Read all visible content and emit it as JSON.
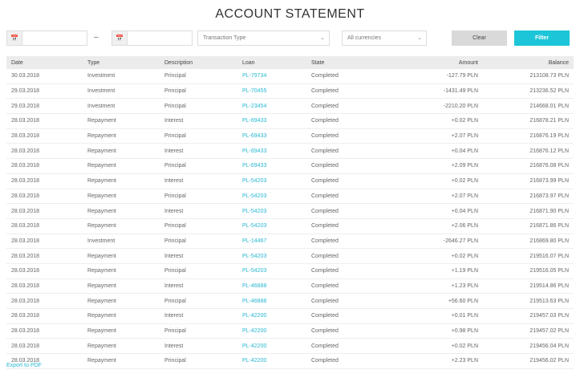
{
  "title": "ACCOUNT STATEMENT",
  "filters": {
    "date_from_value": "",
    "date_to_value": "",
    "dash": "–",
    "transaction_type": "Transaction Type",
    "currency": "All currencies",
    "clear_label": "Clear",
    "filter_label": "Filter"
  },
  "table": {
    "headers": [
      "Date",
      "Type",
      "Description",
      "Loan",
      "State",
      "Amount",
      "Balance"
    ],
    "rows": [
      [
        "30.03.2018",
        "Investment",
        "Principal",
        "PL-79734",
        "Completed",
        "-127.79 PLN",
        "213108.73 PLN"
      ],
      [
        "29.03.2018",
        "Investment",
        "Principal",
        "PL-70455",
        "Completed",
        "-1431.49 PLN",
        "213236.52 PLN"
      ],
      [
        "29.03.2018",
        "Investment",
        "Principal",
        "PL-23454",
        "Completed",
        "-2210.20 PLN",
        "214668.01 PLN"
      ],
      [
        "28.03.2018",
        "Repayment",
        "Interest",
        "PL-69433",
        "Completed",
        "+0.02 PLN",
        "216878.21 PLN"
      ],
      [
        "28.03.2018",
        "Repayment",
        "Principal",
        "PL-69433",
        "Completed",
        "+2.07 PLN",
        "216876.19 PLN"
      ],
      [
        "28.03.2018",
        "Repayment",
        "Interest",
        "PL-69433",
        "Completed",
        "+0.04 PLN",
        "216876.12 PLN"
      ],
      [
        "28.03.2018",
        "Repayment",
        "Principal",
        "PL-69433",
        "Completed",
        "+2.09 PLN",
        "216876.08 PLN"
      ],
      [
        "28.03.2018",
        "Repayment",
        "Interest",
        "PL-54203",
        "Completed",
        "+0.02 PLN",
        "216873.99 PLN"
      ],
      [
        "28.03.2018",
        "Repayment",
        "Principal",
        "PL-54203",
        "Completed",
        "+2.07 PLN",
        "216873.97 PLN"
      ],
      [
        "28.03.2018",
        "Repayment",
        "Interest",
        "PL-54203",
        "Completed",
        "+0.04 PLN",
        "216871.90 PLN"
      ],
      [
        "28.03.2018",
        "Repayment",
        "Principal",
        "PL-54203",
        "Completed",
        "+2.06 PLN",
        "216871.86 PLN"
      ],
      [
        "28.03.2018",
        "Investment",
        "Principal",
        "PL-14467",
        "Completed",
        "-2646.27 PLN",
        "216869.80 PLN"
      ],
      [
        "28.03.2018",
        "Repayment",
        "Interest",
        "PL-54203",
        "Completed",
        "+0.02 PLN",
        "219516.07 PLN"
      ],
      [
        "28.03.2018",
        "Repayment",
        "Principal",
        "PL-54203",
        "Completed",
        "+1.19 PLN",
        "219516.05 PLN"
      ],
      [
        "28.03.2018",
        "Repayment",
        "Interest",
        "PL-46888",
        "Completed",
        "+1.23 PLN",
        "219514.86 PLN"
      ],
      [
        "28.03.2018",
        "Repayment",
        "Principal",
        "PL-46888",
        "Completed",
        "+56.60 PLN",
        "219513.63 PLN"
      ],
      [
        "28.03.2018",
        "Repayment",
        "Interest",
        "PL-42200",
        "Completed",
        "+0.01 PLN",
        "219457.03 PLN"
      ],
      [
        "28.03.2018",
        "Repayment",
        "Principal",
        "PL-42200",
        "Completed",
        "+0.98 PLN",
        "219457.02 PLN"
      ],
      [
        "28.03.2018",
        "Repayment",
        "Interest",
        "PL-42200",
        "Completed",
        "+0.02 PLN",
        "219456.04 PLN"
      ],
      [
        "28.03.2018",
        "Repayment",
        "Principal",
        "PL-42200",
        "Completed",
        "+2.23 PLN",
        "219456.02 PLN"
      ]
    ]
  },
  "export_label": "Export to PDF",
  "icons": {
    "date_from": "calendar-icon",
    "date_to": "calendar-icon",
    "select_chevron": "chevron-down-icon"
  },
  "colors": {
    "accent": "#1cc5d8",
    "link": "#29b7d1",
    "header_bg": "#ececec",
    "clear_bg": "#d9d9d9"
  }
}
